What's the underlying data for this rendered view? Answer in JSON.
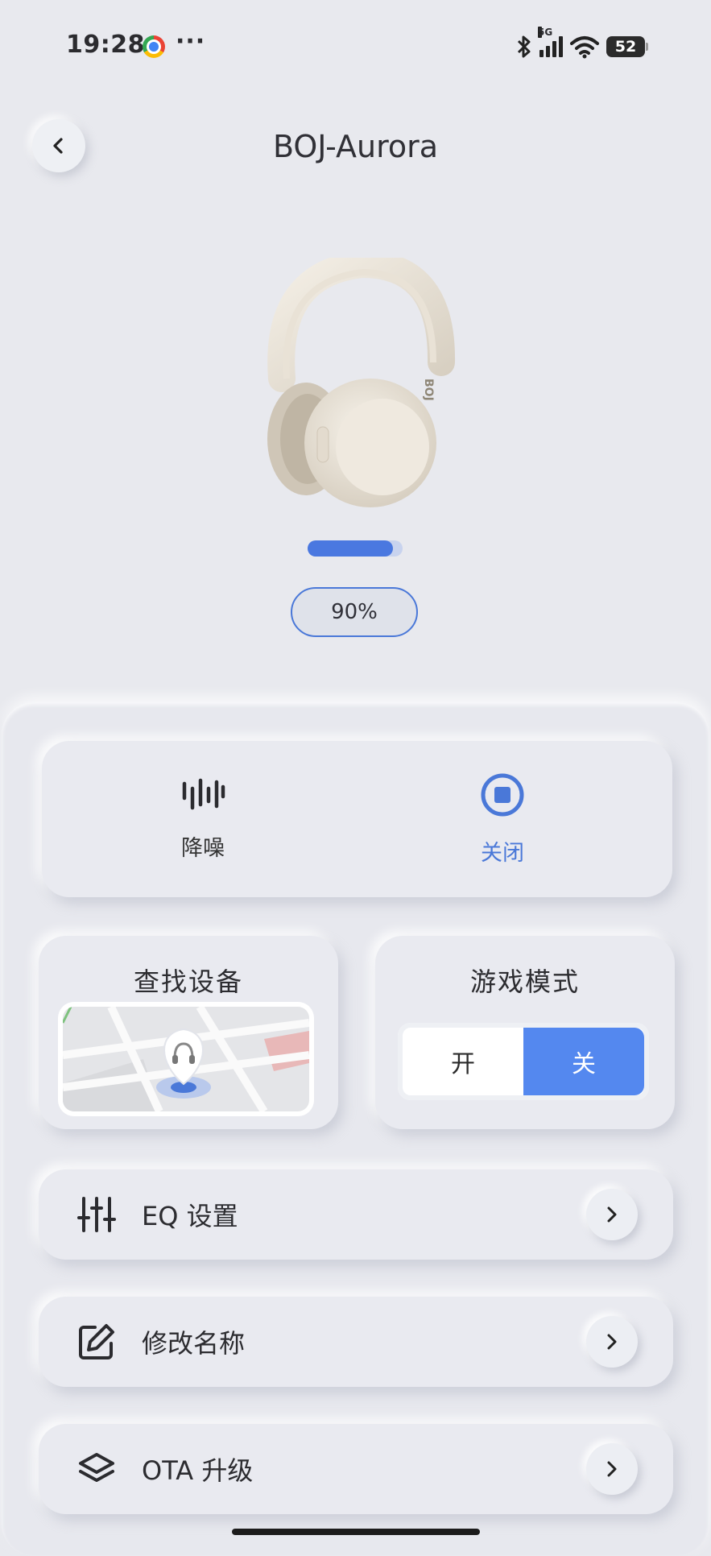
{
  "status_bar": {
    "time": "19:28",
    "dots": "···",
    "network": "5G",
    "battery_level": "52",
    "icons": [
      "chrome-icon",
      "bluetooth-icon",
      "signal-icon",
      "wifi-icon",
      "battery-icon"
    ]
  },
  "header": {
    "title": "BOJ-Aurora",
    "back_icon": "chevron-left-icon"
  },
  "device": {
    "image": "headphone-image",
    "battery_fraction": 0.9,
    "battery_text": "90%"
  },
  "anc": {
    "noise_cancel_label": "降噪",
    "noise_cancel_icon": "sound-wave-icon",
    "off_label": "关闭",
    "off_icon": "stop-circle-icon",
    "selected": "off"
  },
  "find_device": {
    "title": "查找设备",
    "map_icon": "map-icon"
  },
  "game_mode": {
    "title": "游戏模式",
    "on_label": "开",
    "off_label": "关",
    "selected": "off"
  },
  "menu": [
    {
      "label": "EQ 设置",
      "icon": "equalizer-icon"
    },
    {
      "label": "修改名称",
      "icon": "edit-icon"
    },
    {
      "label": "OTA 升级",
      "icon": "layers-icon"
    }
  ],
  "colors": {
    "accent": "#4a78d8",
    "toggle_active": "#5488ef",
    "background": "#e8e9ee"
  }
}
